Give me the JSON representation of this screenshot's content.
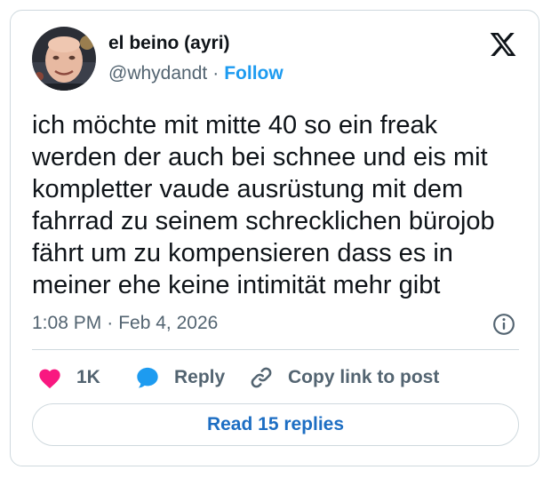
{
  "author": {
    "display_name": "el beino (ayri)",
    "handle": "@whydandt",
    "separator": "·",
    "follow_label": "Follow"
  },
  "tweet": {
    "text": "ich möchte mit mitte 40 so ein freak\nwerden der auch bei schnee und eis mit\nkompletter vaude ausrüstung mit dem\nfahrrad zu seinem schrecklichen bürojob\nfährt um zu kompensieren dass es in\nmeiner ehe keine intimität mehr gibt",
    "time": "1:08 PM",
    "separator": "·",
    "date": "Feb 4, 2026"
  },
  "actions": {
    "like_count": "1K",
    "reply_label": "Reply",
    "copy_label": "Copy link to post"
  },
  "read_replies_label": "Read 15 replies",
  "icons": {
    "brand": "x-logo-icon",
    "info": "info-icon",
    "like": "heart-icon",
    "reply": "speech-bubble-icon",
    "copy": "link-icon"
  },
  "colors": {
    "heart": "#f91880",
    "reply_bubble": "#1d9bf0",
    "follow": "#1d9bf0",
    "read_replies": "#1d6ec3",
    "text_primary": "#0f1419",
    "text_secondary": "#536471",
    "border": "#cfd9de"
  }
}
